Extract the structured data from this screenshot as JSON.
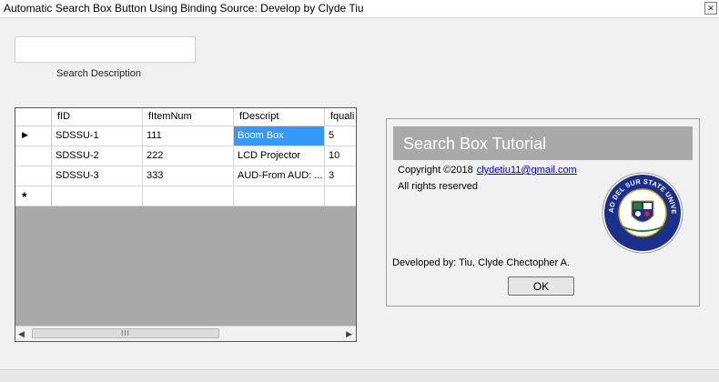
{
  "window": {
    "title": "Automatic Search Box Button Using Binding Source: Develop by Clyde Tiu",
    "close_glyph": "✕"
  },
  "search": {
    "value": "",
    "label": "Search Description"
  },
  "grid": {
    "columns": [
      "fID",
      "fItemNum",
      "fDescript",
      "fquali"
    ],
    "rows": [
      [
        "SDSSU-1",
        "111",
        "Boom Box",
        "5"
      ],
      [
        "SDSSU-2",
        "222",
        "LCD Projector",
        "10"
      ],
      [
        "SDSSU-3",
        "333",
        "AUD-From AUD: ...",
        "3"
      ]
    ],
    "current_row_glyph": "▶",
    "new_row_glyph": "*",
    "scroll_left_glyph": "◀",
    "scroll_right_glyph": "▶",
    "scroll_thumb_grip": "III",
    "selected_cell_color": "#3399ff"
  },
  "panel": {
    "title": "Search Box Tutorial",
    "copyright": "Copyright ©2018",
    "email": "clydetiu11@gmail.com",
    "rights": "All rights reserved",
    "developed_by": "Developed by: Tiu, Clyde Chectopher A.",
    "ok_label": "OK",
    "seal_text": "SURIGAO DEL SUR STATE UNIVERSITY",
    "seal_subtext": "CANTILAN CAMPUS"
  }
}
